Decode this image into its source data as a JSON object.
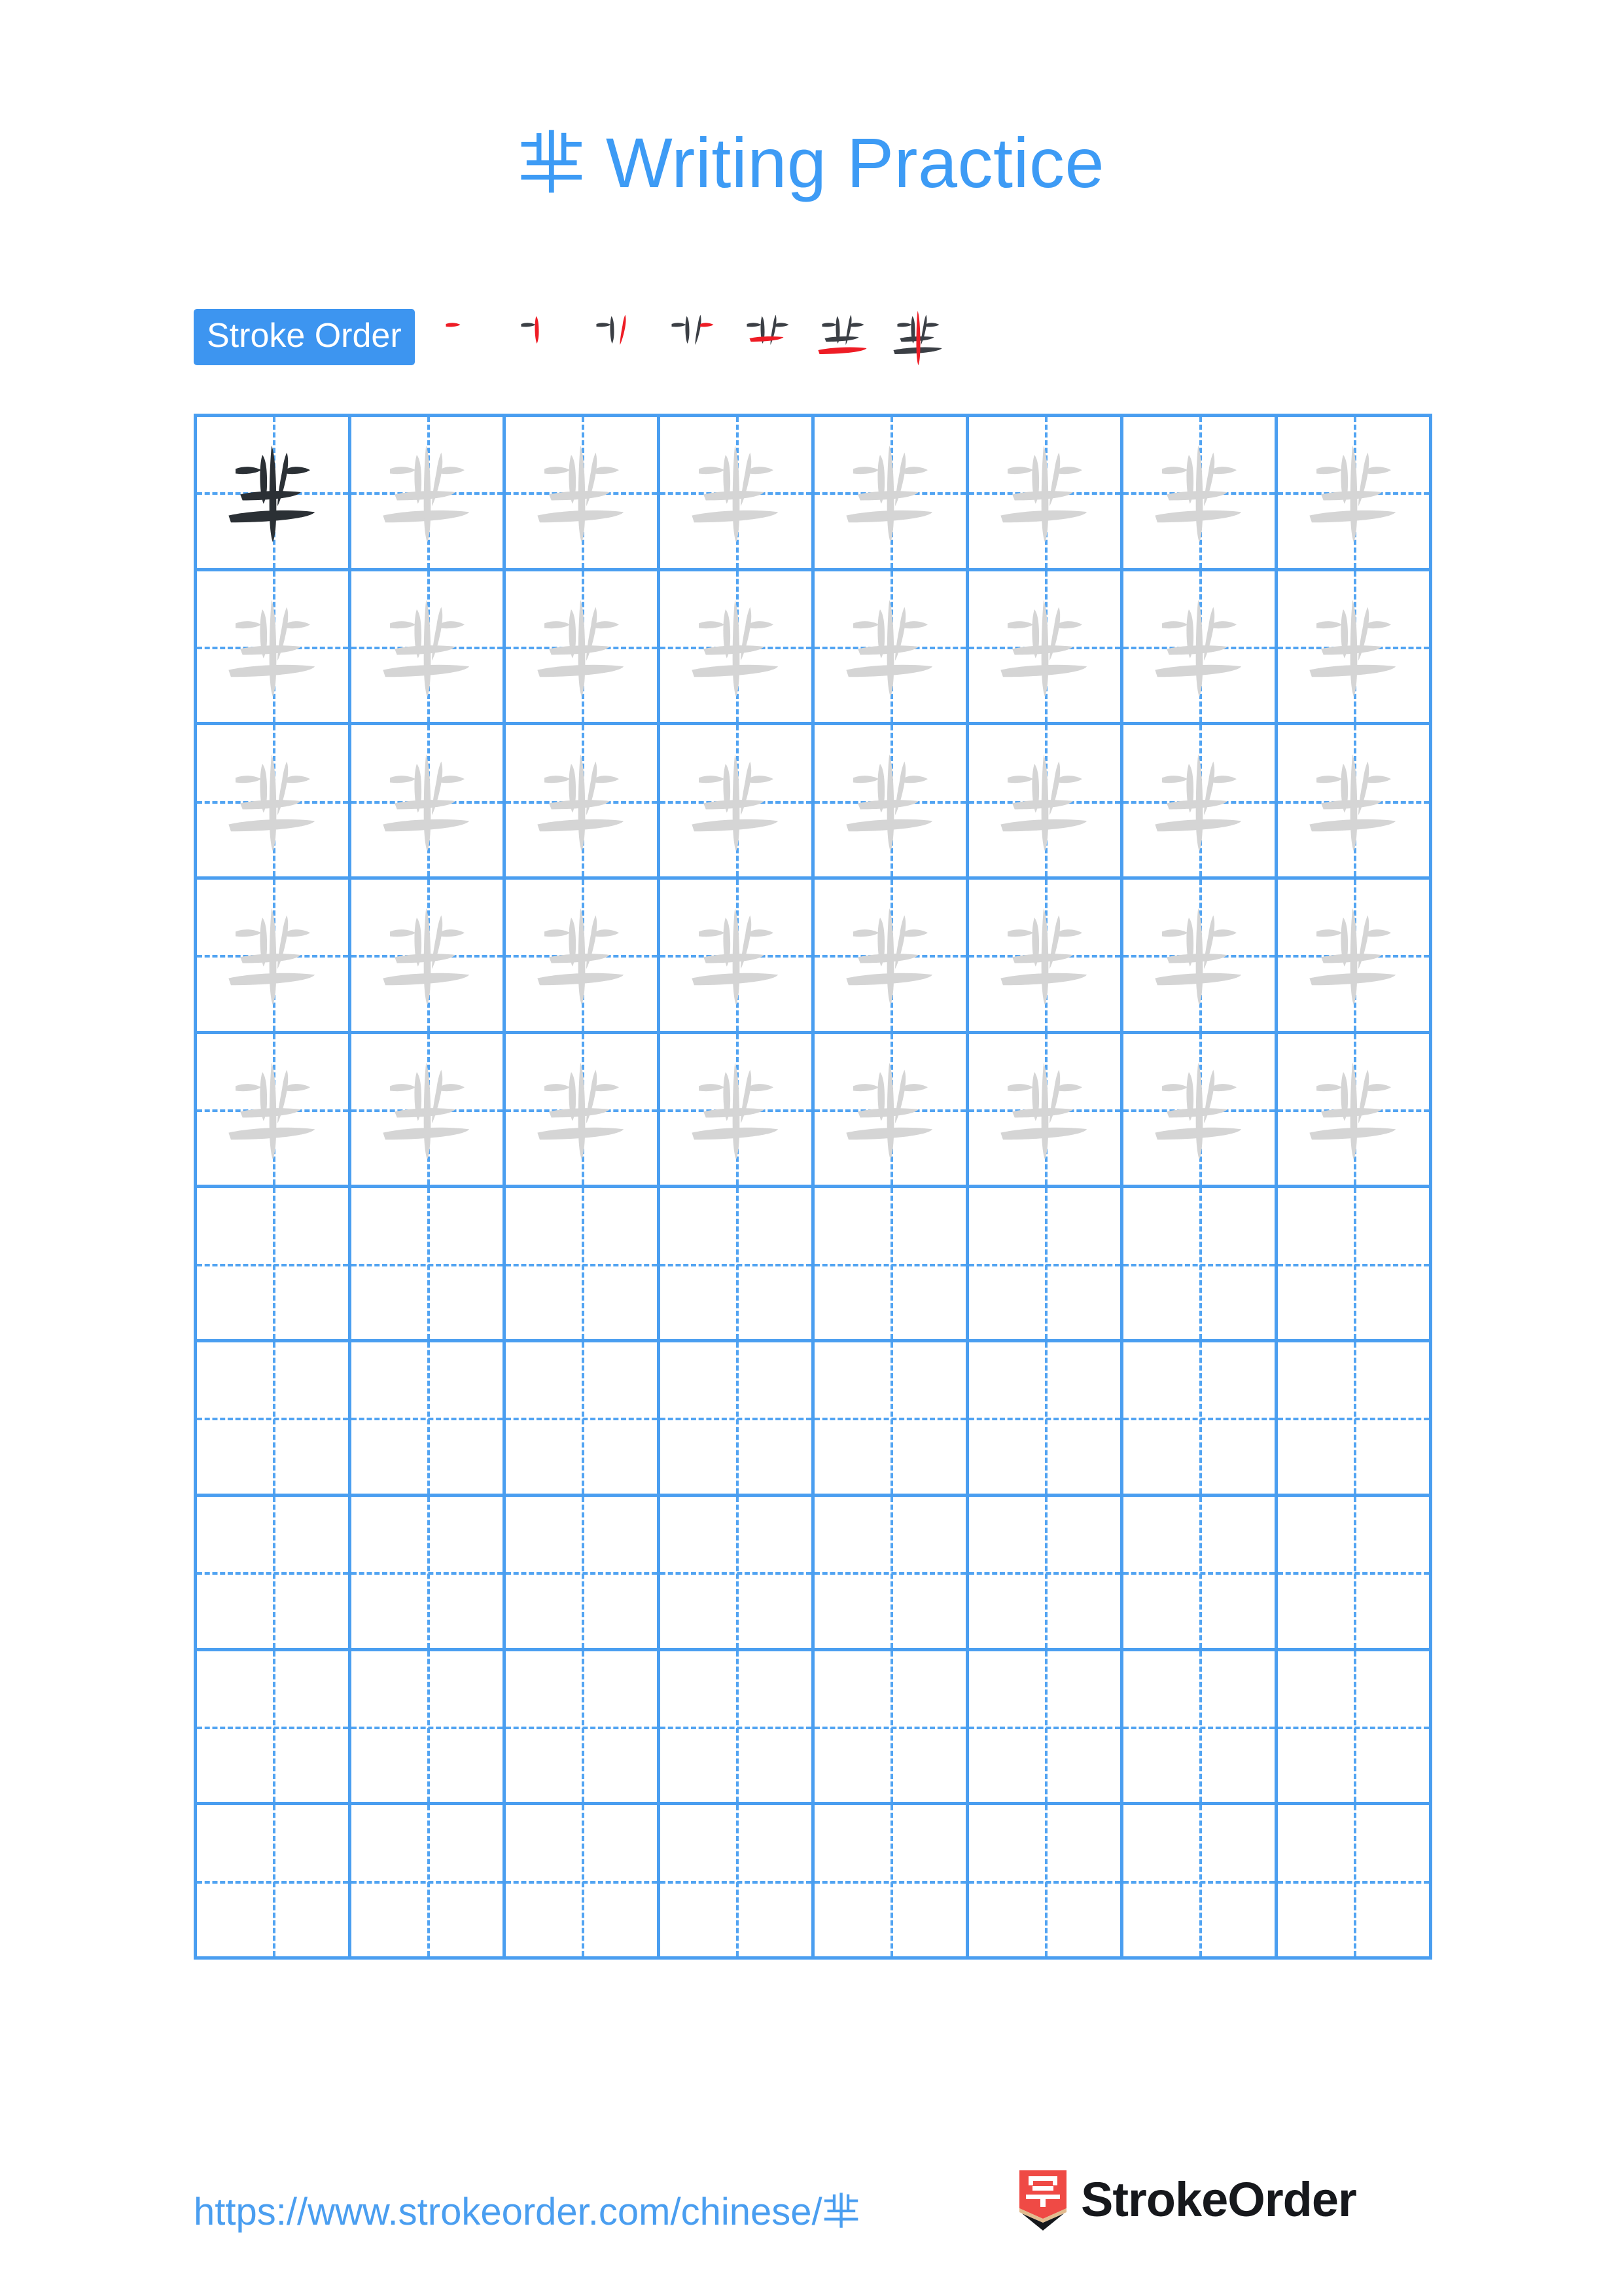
{
  "page": {
    "character": "芈",
    "title_suffix": " Writing Practice",
    "title_full": "芈 Writing Practice",
    "background_color": "#ffffff",
    "accent_color": "#3d9bf5",
    "grid_line_color": "#4a9ef0",
    "guide_line_color": "#52a4f2",
    "trace_char_color": "#d5d5d5",
    "solid_char_color": "#2b3035",
    "new_stroke_color": "#ee1c25"
  },
  "stroke_order": {
    "label": "Stroke Order",
    "badge_bg": "#3d95f0",
    "badge_text_color": "#ffffff",
    "total_strokes": 7,
    "steps": [
      {
        "index": 1,
        "strokes_shown": 1,
        "new_stroke": 1
      },
      {
        "index": 2,
        "strokes_shown": 2,
        "new_stroke": 2
      },
      {
        "index": 3,
        "strokes_shown": 3,
        "new_stroke": 3
      },
      {
        "index": 4,
        "strokes_shown": 4,
        "new_stroke": 4
      },
      {
        "index": 5,
        "strokes_shown": 5,
        "new_stroke": 5
      },
      {
        "index": 6,
        "strokes_shown": 6,
        "new_stroke": 6
      },
      {
        "index": 7,
        "strokes_shown": 7,
        "new_stroke": 7
      }
    ]
  },
  "grid": {
    "rows": 10,
    "columns": 8,
    "row_fill": [
      [
        "solid",
        "trace",
        "trace",
        "trace",
        "trace",
        "trace",
        "trace",
        "trace"
      ],
      [
        "trace",
        "trace",
        "trace",
        "trace",
        "trace",
        "trace",
        "trace",
        "trace"
      ],
      [
        "trace",
        "trace",
        "trace",
        "trace",
        "trace",
        "trace",
        "trace",
        "trace"
      ],
      [
        "trace",
        "trace",
        "trace",
        "trace",
        "trace",
        "trace",
        "trace",
        "trace"
      ],
      [
        "trace",
        "trace",
        "trace",
        "trace",
        "trace",
        "trace",
        "trace",
        "trace"
      ],
      [
        "empty",
        "empty",
        "empty",
        "empty",
        "empty",
        "empty",
        "empty",
        "empty"
      ],
      [
        "empty",
        "empty",
        "empty",
        "empty",
        "empty",
        "empty",
        "empty",
        "empty"
      ],
      [
        "empty",
        "empty",
        "empty",
        "empty",
        "empty",
        "empty",
        "empty",
        "empty"
      ],
      [
        "empty",
        "empty",
        "empty",
        "empty",
        "empty",
        "empty",
        "empty",
        "empty"
      ],
      [
        "empty",
        "empty",
        "empty",
        "empty",
        "empty",
        "empty",
        "empty",
        "empty"
      ]
    ]
  },
  "footer": {
    "url": "https://www.strokeorder.com/chinese/芈",
    "logo_text": "StrokeOrder",
    "logo_glyph": "字",
    "logo_bg_color": "#ef4a45",
    "logo_wood_color": "#e2bc8f"
  }
}
